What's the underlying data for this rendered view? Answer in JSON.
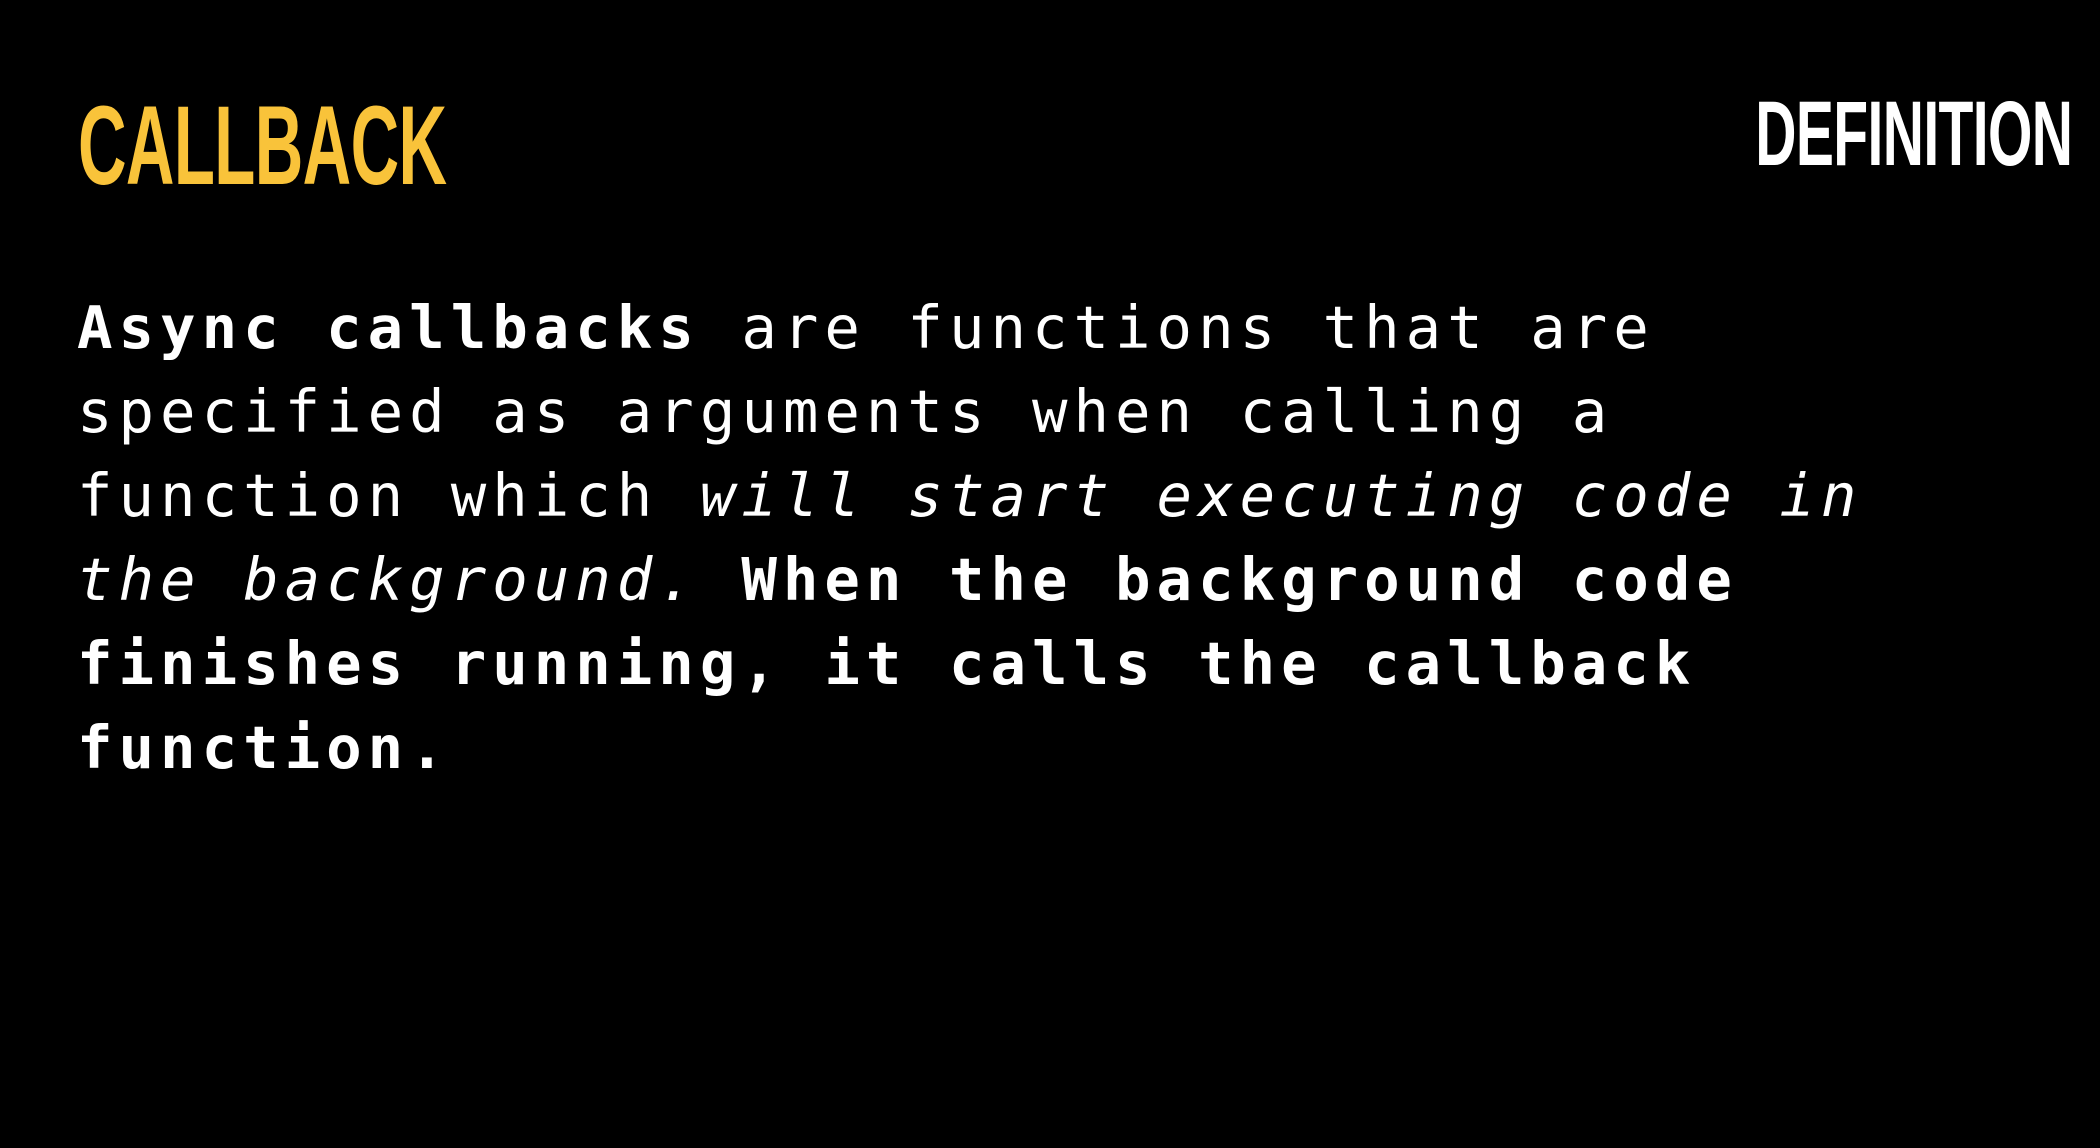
{
  "slide": {
    "title": "CALLBACK",
    "tag": "DEFINITION",
    "colors": {
      "background": "#000000",
      "title": "#F9C33A",
      "text": "#FFFFFF"
    },
    "body": {
      "line1_bold": "Async callbacks",
      "line1_rest": " are functions that are",
      "line2": "specified as arguments when calling a",
      "line3_normal": "function which ",
      "line3_italic": "will start executing code in",
      "line4_italic": "the background.",
      "line4_bold": " When the background code",
      "line5_bold": "finishes running, it calls the callback",
      "line6_bold": "function."
    }
  }
}
